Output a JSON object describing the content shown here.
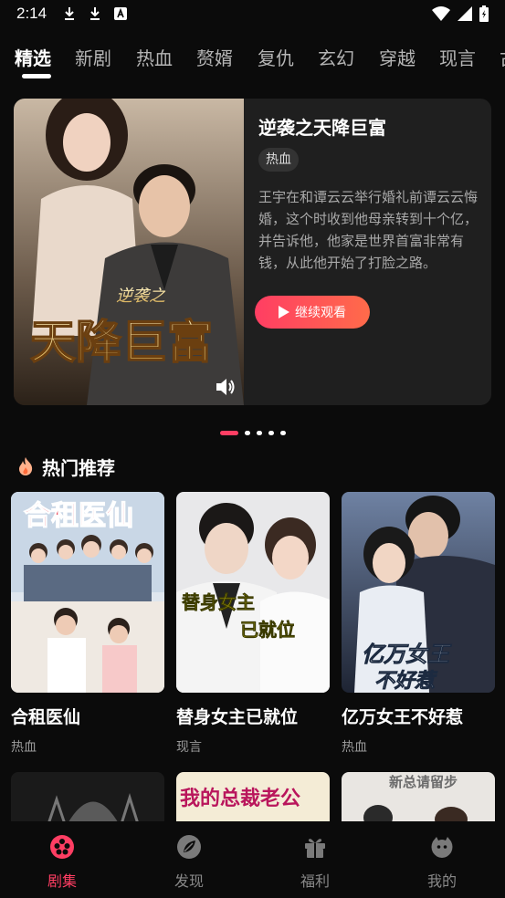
{
  "status_bar": {
    "time": "2:14"
  },
  "tabs": [
    "精选",
    "新剧",
    "热血",
    "赘婿",
    "复仇",
    "玄幻",
    "穿越",
    "现言",
    "古"
  ],
  "hero": {
    "title": "逆袭之天降巨富",
    "tag": "热血",
    "description": "王宇在和谭云云举行婚礼前谭云云悔婚，这个时收到他母亲转到十个亿，并告诉他，他家是世界首富非常有钱，从此他开始了打脸之路。",
    "button_label": "继续观看",
    "poster_text_small": "逆袭之",
    "poster_text_big": "天降巨富"
  },
  "carousel": {
    "count": 5,
    "active_index": 0
  },
  "section": {
    "title": "热门推荐",
    "icon": "flame-icon"
  },
  "cards": [
    {
      "name": "合租医仙",
      "genre": "热血",
      "poster_text": "合租医仙"
    },
    {
      "name": "替身女主已就位",
      "genre": "现言",
      "poster_text_1": "替身女主",
      "poster_text_2": "已就位"
    },
    {
      "name": "亿万女王不好惹",
      "genre": "热血",
      "poster_text_1": "亿万女王",
      "poster_text_2": "不好惹"
    }
  ],
  "partial_cards": [
    {
      "poster_text": ""
    },
    {
      "poster_text": "我的总裁老公"
    },
    {
      "poster_text": "新总请留步"
    }
  ],
  "bottom_nav": [
    {
      "label": "剧集",
      "icon": "film-reel-icon",
      "active": true
    },
    {
      "label": "发现",
      "icon": "compass-leaf-icon",
      "active": false
    },
    {
      "label": "福利",
      "icon": "gift-icon",
      "active": false
    },
    {
      "label": "我的",
      "icon": "profile-face-icon",
      "active": false
    }
  ],
  "colors": {
    "accent": "#ff3e63",
    "background": "#0b0b0b",
    "card": "#1f1f1f"
  }
}
